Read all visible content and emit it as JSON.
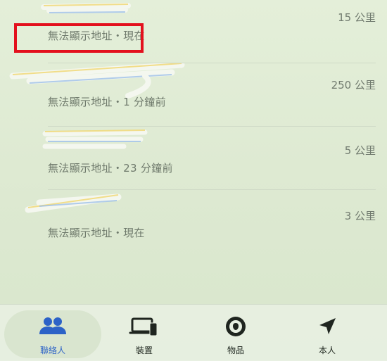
{
  "people": [
    {
      "status": "無法顯示地址・現在",
      "distance": "15 公里"
    },
    {
      "status": "無法顯示地址・1 分鐘前",
      "distance": "250 公里"
    },
    {
      "status": "無法顯示地址・23 分鐘前",
      "distance": "5 公里"
    },
    {
      "status": "無法顯示地址・現在",
      "distance": "3 公里"
    }
  ],
  "tabs": [
    {
      "label": "聯絡人",
      "icon": "people-icon",
      "active": true
    },
    {
      "label": "裝置",
      "icon": "devices-icon",
      "active": false
    },
    {
      "label": "物品",
      "icon": "airtag-icon",
      "active": false
    },
    {
      "label": "本人",
      "icon": "location-arrow-icon",
      "active": false
    }
  ],
  "colors": {
    "accent": "#2c62c7",
    "highlight": "#e3101d"
  }
}
